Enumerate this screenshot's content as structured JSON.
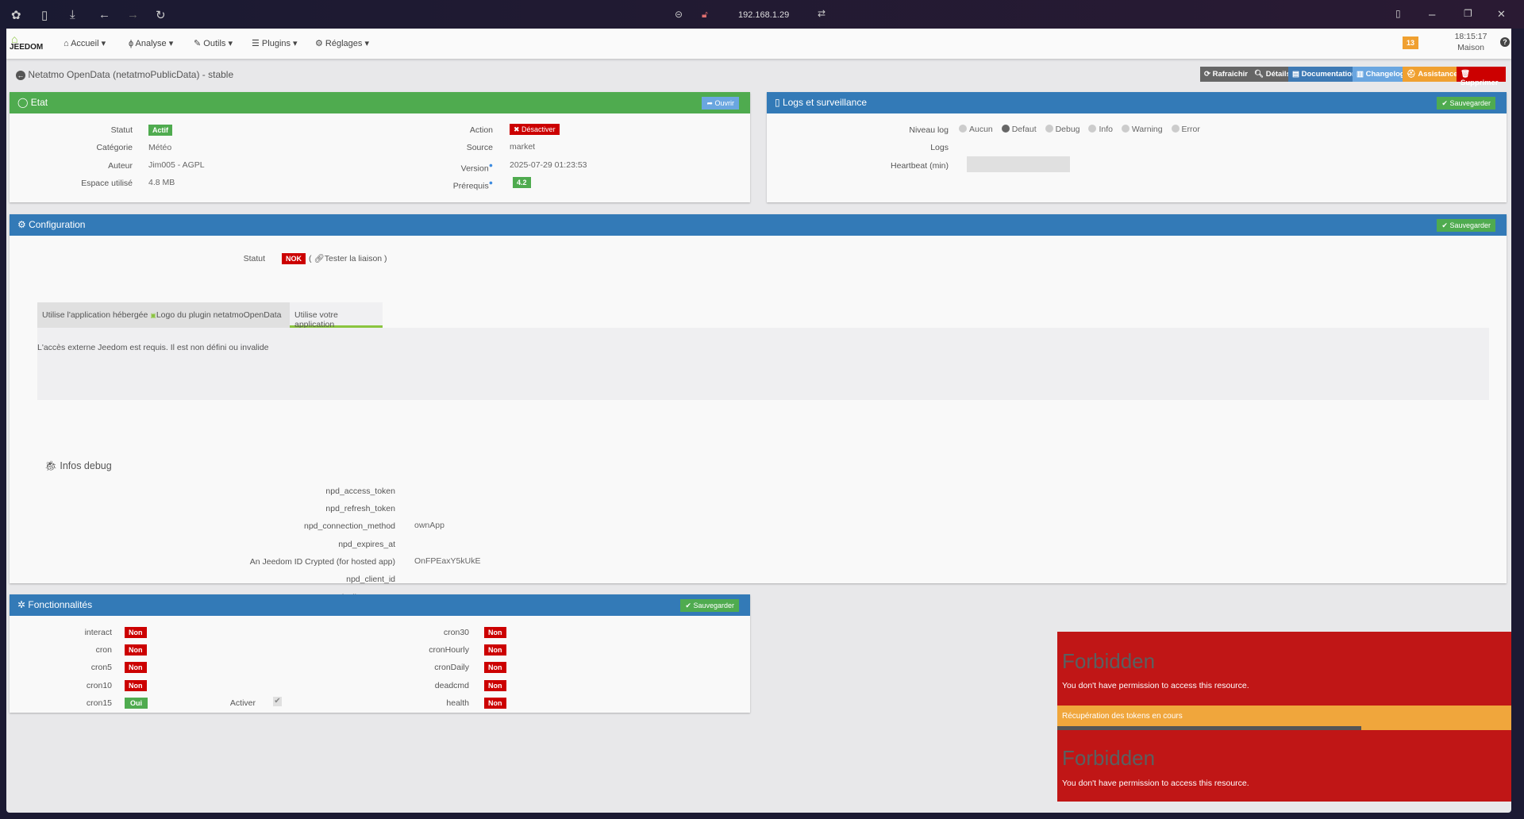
{
  "browser": {
    "url": "192.168.1.29"
  },
  "nav": {
    "logo": "JEEDOM",
    "items": [
      "Accueil",
      "Analyse",
      "Outils",
      "Plugins",
      "Réglages"
    ],
    "badge": "13",
    "time": "18:15:17",
    "location": "Maison"
  },
  "page": {
    "title": "Netatmo OpenData (netatmoPublicData) - stable",
    "toolbar": [
      "Rafraichir",
      "Détails",
      "Documentation",
      "Changelog",
      "Assistance",
      "Supprimer"
    ]
  },
  "etat": {
    "title": "Etat",
    "open": "Ouvrir",
    "left": [
      {
        "label": "Statut",
        "value": "Actif"
      },
      {
        "label": "Catégorie",
        "value": "Météo"
      },
      {
        "label": "Auteur",
        "value": "Jim005 - AGPL"
      },
      {
        "label": "Espace utilisé",
        "value": "4.8 MB"
      }
    ],
    "right": [
      {
        "label": "Action",
        "value": "Désactiver"
      },
      {
        "label": "Source",
        "value": "market"
      },
      {
        "label": "Version",
        "value": "2025-07-29 01:23:53"
      },
      {
        "label": "Prérequis",
        "value": "4.2"
      }
    ]
  },
  "logs": {
    "title": "Logs et surveillance",
    "save": "Sauvegarder",
    "level_label": "Niveau log",
    "levels": [
      "Aucun",
      "Defaut",
      "Debug",
      "Info",
      "Warning",
      "Error"
    ],
    "selected": "Defaut",
    "logs_label": "Logs",
    "heartbeat_label": "Heartbeat (min)",
    "heartbeat_value": ""
  },
  "config": {
    "title": "Configuration",
    "save": "Sauvegarder",
    "status_label": "Statut",
    "status": "NOK",
    "test_link": "Tester la liaison",
    "tabs": [
      "Utilise l'application hébergée",
      "Utilise votre application"
    ],
    "tab_img_alt": "Logo du plugin netatmoOpenData",
    "active_tab": 1,
    "message": "L'accès externe Jeedom est requis. Il est non défini ou invalide",
    "debug_title": "Infos debug",
    "debug": [
      {
        "label": "npd_access_token",
        "value": ""
      },
      {
        "label": "npd_refresh_token",
        "value": ""
      },
      {
        "label": "npd_connection_method",
        "value": "ownApp"
      },
      {
        "label": "npd_expires_at",
        "value": ""
      },
      {
        "label": "An Jeedom ID Crypted (for hosted app)",
        "value": "OnFPEaxY5kUkE"
      },
      {
        "label": "npd_client_id",
        "value": ""
      },
      {
        "label": "npd_client_secret",
        "value": ""
      }
    ]
  },
  "features": {
    "title": "Fonctionnalités",
    "save": "Sauvegarder",
    "activate_label": "Activer",
    "left": [
      {
        "label": "interact",
        "value": "Non"
      },
      {
        "label": "cron",
        "value": "Non"
      },
      {
        "label": "cron5",
        "value": "Non"
      },
      {
        "label": "cron10",
        "value": "Non"
      },
      {
        "label": "cron15",
        "value": "Oui"
      }
    ],
    "right": [
      {
        "label": "cron30",
        "value": "Non"
      },
      {
        "label": "cronHourly",
        "value": "Non"
      },
      {
        "label": "cronDaily",
        "value": "Non"
      },
      {
        "label": "deadcmd",
        "value": "Non"
      },
      {
        "label": "health",
        "value": "Non"
      }
    ]
  },
  "alerts": {
    "forbidden_title": "Forbidden",
    "forbidden_msg": "You don't have permission to access this resource.",
    "progress_label": "Récupération des tokens en cours",
    "progress": 0.67
  }
}
